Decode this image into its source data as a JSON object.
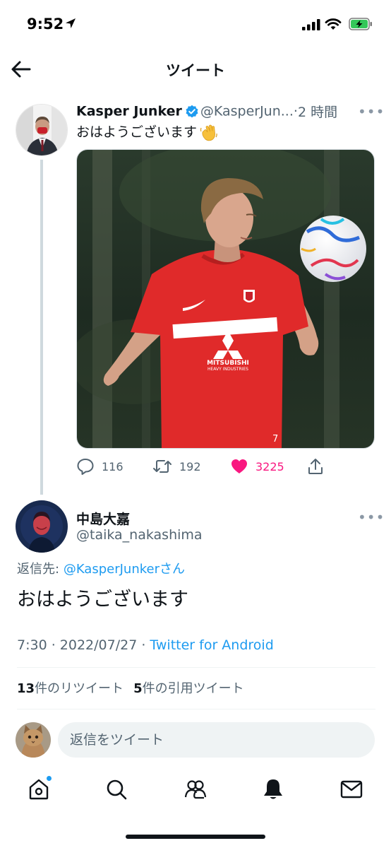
{
  "status_bar": {
    "time": "9:52",
    "icons": [
      "location-arrow-icon",
      "signal-icon",
      "wifi-icon",
      "battery-charging-icon"
    ]
  },
  "header": {
    "back_icon": "arrow-left-icon",
    "title": "ツイート"
  },
  "tweet": {
    "author_name": "Kasper Junker",
    "verified": true,
    "handle": "@KasperJun...",
    "separator": "·",
    "time": "2 時間",
    "text": "おはようございます",
    "emoji_icon": "waving-hand-icon",
    "more_icon": "more-horizontal-icon",
    "media": {
      "jersey_sponsor_top": "MITSUBISHI",
      "jersey_sponsor_bottom": "HEAVY INDUSTRIES",
      "jersey_number": "7"
    },
    "actions": {
      "reply_count": "116",
      "retweet_count": "192",
      "like_count": "3225",
      "liked": true
    }
  },
  "reply": {
    "author_name": "中島大嘉",
    "handle": "@taika_nakashima",
    "reply_to_prefix": "返信先:",
    "reply_to_user": "@KasperJunker",
    "reply_to_suffix": "さん",
    "text": "おはようございます",
    "timestamp": "7:30 · 2022/07/27 ·",
    "source": "Twitter for Android",
    "retweets_num": "13",
    "retweets_label": "件のリツイート",
    "quotes_num": "5",
    "quotes_label": "件の引用ツイート",
    "more_icon": "more-horizontal-icon"
  },
  "compose": {
    "placeholder": "返信をツイート"
  },
  "tabbar": {
    "items": [
      "home-icon",
      "search-icon",
      "communities-icon",
      "notifications-icon",
      "messages-icon"
    ],
    "active": "notifications-icon",
    "home_badge": true
  },
  "colors": {
    "accent": "#1d9bf0",
    "like": "#f91880",
    "text": "#0f1419",
    "secondary": "#536471",
    "jersey": "#e02a2a"
  }
}
